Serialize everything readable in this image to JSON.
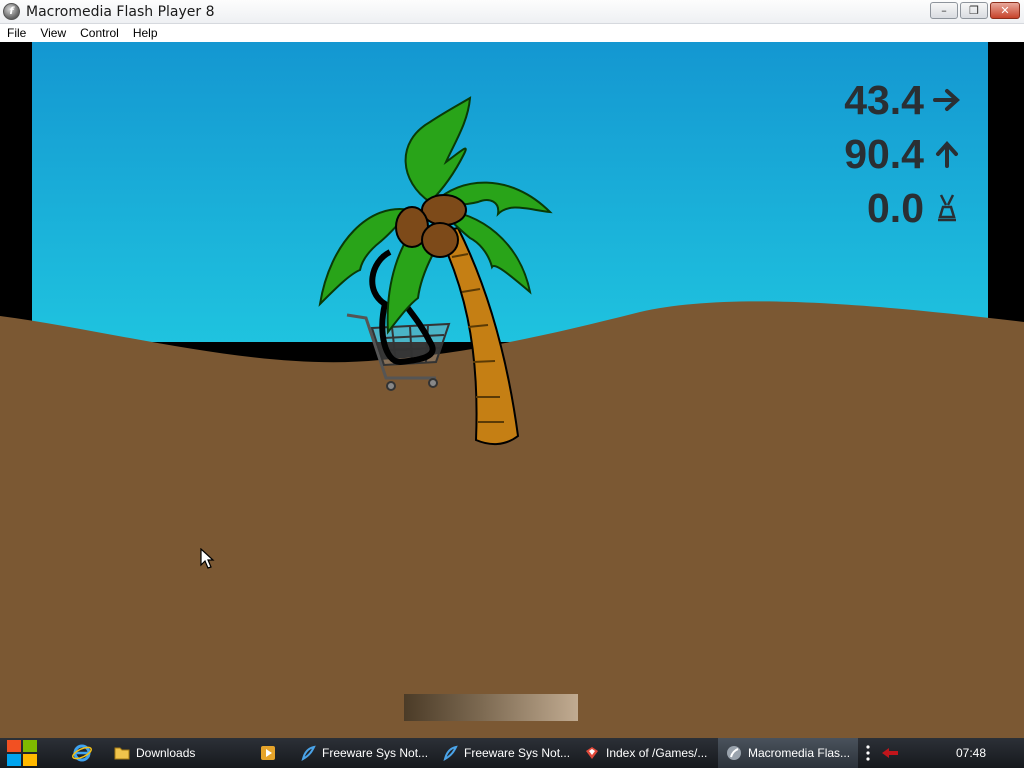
{
  "window": {
    "title": "Macromedia Flash Player 8",
    "controls": {
      "minimize": "–",
      "maximize": "❐",
      "close": "✕"
    }
  },
  "menu": {
    "items": [
      "File",
      "View",
      "Control",
      "Help"
    ]
  },
  "game": {
    "hud": {
      "distance": "43.4",
      "distance_icon": "arrow-right-icon",
      "height": "90.4",
      "height_icon": "arrow-up-icon",
      "third": "0.0",
      "third_icon": "weight-icon"
    },
    "power_level": 1.0,
    "colors": {
      "sky_top": "#1497d1",
      "sky_bottom": "#1fc3df",
      "ground": "#7b5833",
      "palm_leaf": "#29a419",
      "palm_trunk": "#c57f14",
      "coconut": "#7d4a19",
      "hud_text": "#2a2f33"
    }
  },
  "taskbar": {
    "start_icon": "windows-logo-icon",
    "pinned": [
      {
        "icon": "internet-explorer-icon"
      }
    ],
    "tasks": [
      {
        "label": "Downloads",
        "icon": "folder-icon",
        "active": false
      },
      {
        "label": "",
        "icon": "media-player-icon",
        "active": false
      },
      {
        "label": "Freeware Sys Not...",
        "icon": "app-icon",
        "active": false
      },
      {
        "label": "Freeware Sys Not...",
        "icon": "app-icon",
        "active": false
      },
      {
        "label": "Index of /Games/...",
        "icon": "browser-icon",
        "active": false
      },
      {
        "label": "Macromedia Flas...",
        "icon": "flash-player-icon",
        "active": true
      }
    ],
    "clock": "07:48"
  }
}
